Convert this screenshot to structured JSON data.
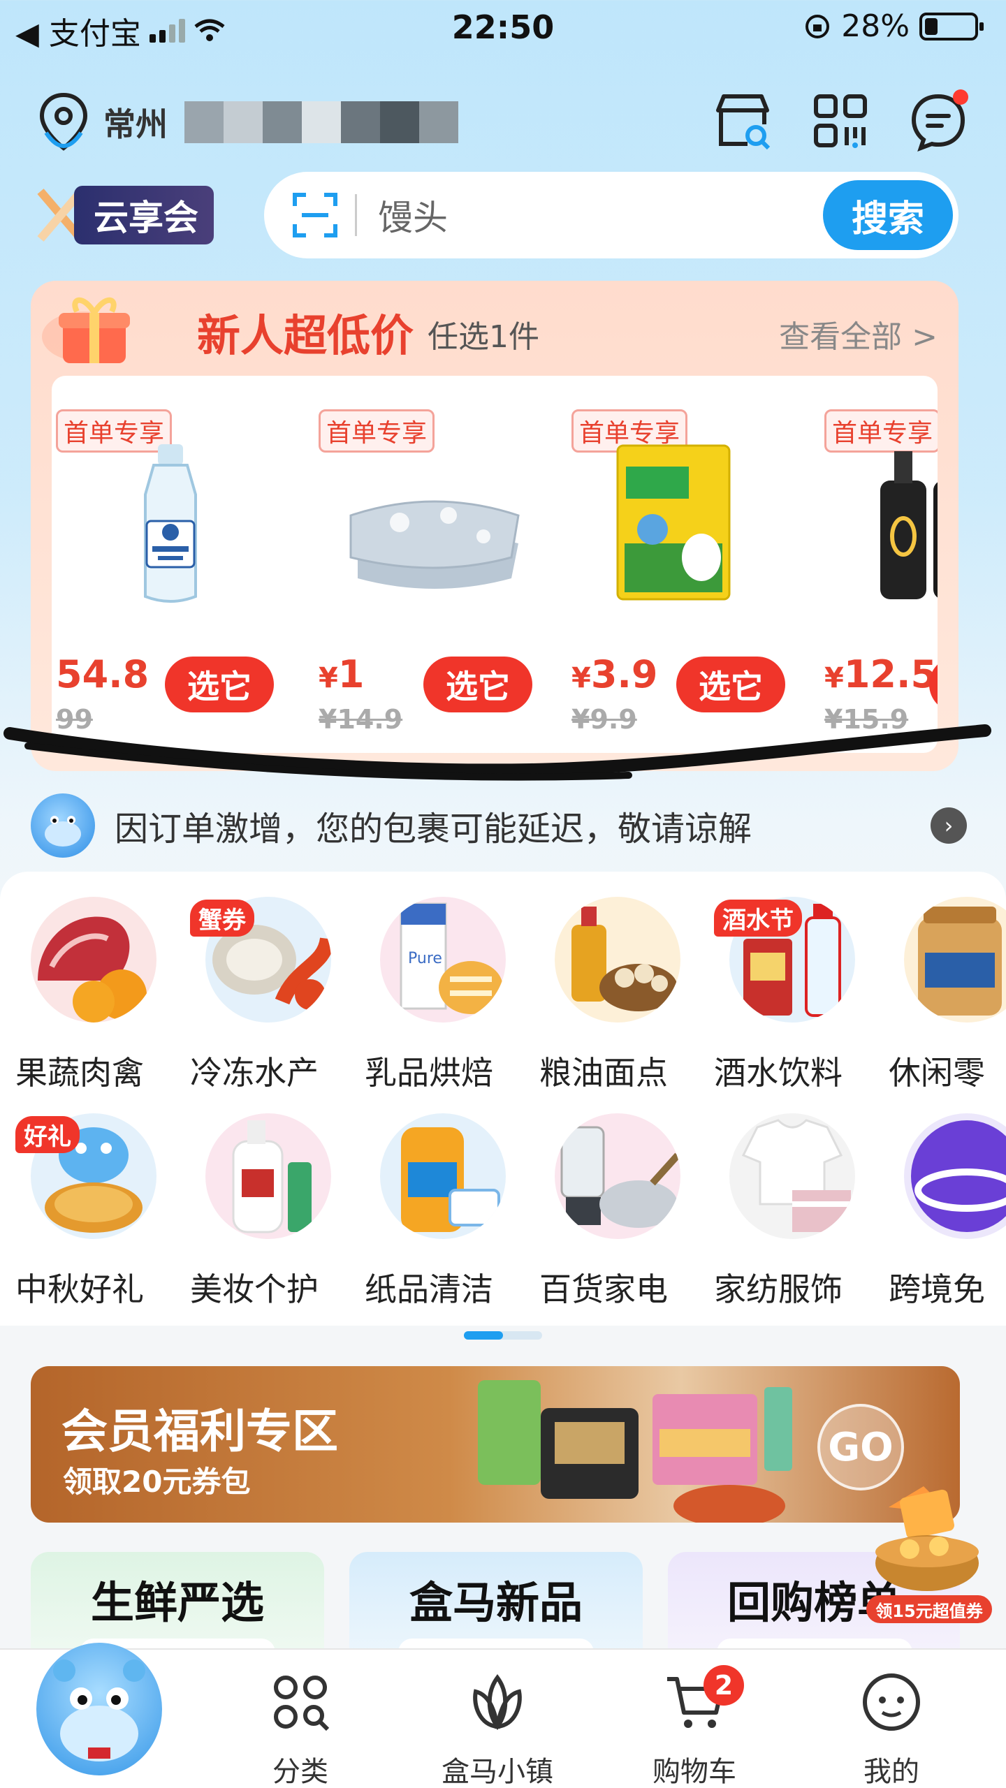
{
  "status_bar": {
    "back_label": "◀ 支付宝",
    "time": "22:50",
    "battery_percent": "28%"
  },
  "header": {
    "location": "常州",
    "icons": [
      "store-search-icon",
      "qr-code-icon",
      "message-icon"
    ]
  },
  "search": {
    "brand_badge": "云享会",
    "placeholder": "馒头",
    "button_label": "搜索"
  },
  "promo": {
    "title": "新人超低价",
    "subtitle": "任选1件",
    "view_all": "查看全部 >",
    "products": [
      {
        "tag": "首单专享",
        "price": "54.8",
        "orig": "99",
        "button": "选它",
        "icon": "soda-water-bottle"
      },
      {
        "tag": "首单专享",
        "price_symbol": "¥",
        "price": "1",
        "orig": "¥14.9",
        "button": "选它",
        "icon": "pillow"
      },
      {
        "tag": "首单专享",
        "price_symbol": "¥",
        "price": "3.9",
        "orig": "¥9.9",
        "button": "选它",
        "icon": "seasoning-bag"
      },
      {
        "tag": "首单专享",
        "price_symbol": "¥",
        "price": "12.5",
        "orig": "¥15.9",
        "button": "选",
        "icon": "soy-sauce-bottles"
      }
    ]
  },
  "notice": {
    "text": "因订单激增，您的包裹可能延迟，敬请谅解"
  },
  "categories": {
    "row1": [
      {
        "label": "果蔬肉禽",
        "badge": ""
      },
      {
        "label": "冷冻水产",
        "badge": "蟹券"
      },
      {
        "label": "乳品烘焙",
        "badge": ""
      },
      {
        "label": "粮油面点",
        "badge": ""
      },
      {
        "label": "酒水饮料",
        "badge": "酒水节"
      },
      {
        "label": "休闲零",
        "badge": ""
      }
    ],
    "row2": [
      {
        "label": "中秋好礼",
        "badge": "好礼"
      },
      {
        "label": "美妆个护",
        "badge": ""
      },
      {
        "label": "纸品清洁",
        "badge": ""
      },
      {
        "label": "百货家电",
        "badge": ""
      },
      {
        "label": "家纺服饰",
        "badge": ""
      },
      {
        "label": "跨境免",
        "badge": ""
      }
    ]
  },
  "member_banner": {
    "title": "会员福利专区",
    "subtitle": "领取20元券包",
    "go": "GO"
  },
  "sections": [
    {
      "title": "生鲜严选"
    },
    {
      "title": "盒马新品"
    },
    {
      "title": "回购榜单"
    }
  ],
  "float_coupon": {
    "label": "领15元超值券"
  },
  "tabbar": {
    "tabs": [
      {
        "label": "分类",
        "icon": "category-grid-icon"
      },
      {
        "label": "盒马小镇",
        "icon": "lotus-icon"
      },
      {
        "label": "购物车",
        "icon": "cart-icon",
        "badge": "2"
      },
      {
        "label": "我的",
        "icon": "smile-face-icon"
      }
    ]
  },
  "colors": {
    "accent_blue": "#1e9ef0",
    "accent_red": "#f0352a",
    "promo_red": "#e8412e"
  }
}
